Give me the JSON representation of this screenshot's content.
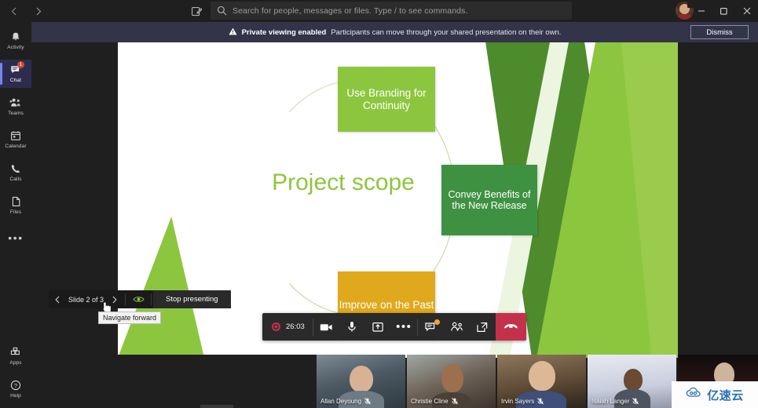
{
  "titlebar": {
    "back_icon": "chevron-left-icon",
    "forward_icon": "chevron-right-icon",
    "compose_icon": "compose-new-chat-icon",
    "search": {
      "icon": "search-icon",
      "placeholder": "Search for people, messages or files. Type / to see commands."
    },
    "avatar_name": "user-avatar",
    "minimize_label": "—",
    "maximize_label": "❐",
    "close_label": "✕"
  },
  "rail": {
    "items": [
      {
        "label": "Activity",
        "icon": "bell-icon",
        "selected": false,
        "badge": ""
      },
      {
        "label": "Chat",
        "icon": "chat-icon",
        "selected": true,
        "badge": "1"
      },
      {
        "label": "Teams",
        "icon": "teams-icon",
        "selected": false,
        "badge": ""
      },
      {
        "label": "Calendar",
        "icon": "calendar-icon",
        "selected": false,
        "badge": ""
      },
      {
        "label": "Calls",
        "icon": "phone-icon",
        "selected": false,
        "badge": ""
      },
      {
        "label": "Files",
        "icon": "files-icon",
        "selected": false,
        "badge": ""
      }
    ],
    "more_label": "•••",
    "bottom_items": [
      {
        "label": "Apps",
        "icon": "apps-icon"
      },
      {
        "label": "Help",
        "icon": "help-icon"
      }
    ]
  },
  "banner": {
    "warning_icon": "warning-triangle-icon",
    "strong": "Private viewing enabled",
    "text": "Participants can move through your shared presentation on their own.",
    "dismiss_label": "Dismiss"
  },
  "slide": {
    "title": "Project scope",
    "boxes": [
      {
        "text": "Use Branding for Continuity",
        "color": "#8cc63f"
      },
      {
        "text": "Convey Benefits of the New Release",
        "color": "#3f9142"
      },
      {
        "text": "Improve on the Past",
        "color": "#e0a81c"
      }
    ],
    "page_number": "2"
  },
  "presenter_controls": {
    "prev_icon": "chevron-left-icon",
    "next_icon": "chevron-right-icon",
    "slide_label": "Slide 2 of 3",
    "eye_icon": "private-view-eye-icon",
    "stop_label": "Stop presenting",
    "tooltip": "Navigate forward"
  },
  "callbar": {
    "recording_icon": "recording-dot-icon",
    "duration": "26:03",
    "buttons": [
      {
        "name": "camera-button",
        "icon": "video-camera-icon",
        "badge": false
      },
      {
        "name": "microphone-button",
        "icon": "microphone-icon",
        "badge": false
      },
      {
        "name": "share-screen-button",
        "icon": "share-screen-icon",
        "badge": false
      },
      {
        "name": "more-actions-button",
        "icon": "ellipsis-icon",
        "badge": false
      },
      {
        "name": "chat-button",
        "icon": "chat-bubble-icon",
        "badge": true
      },
      {
        "name": "participants-button",
        "icon": "people-icon",
        "badge": false
      },
      {
        "name": "breakout-rooms-button",
        "icon": "breakout-rooms-icon",
        "badge": false
      }
    ],
    "hangup_icon": "hangup-phone-icon"
  },
  "participants": [
    {
      "name": "Allan Deyoung",
      "muted": true
    },
    {
      "name": "Christie Cline",
      "muted": true
    },
    {
      "name": "Irvin Sayers",
      "muted": true
    },
    {
      "name": "Isaiah Langer",
      "muted": true
    },
    {
      "name": "",
      "muted": false
    }
  ],
  "watermark": {
    "text": "亿速云",
    "icon": "cloud-logo-icon"
  }
}
